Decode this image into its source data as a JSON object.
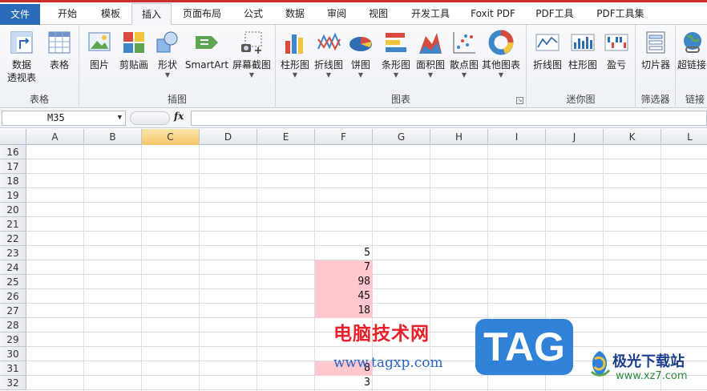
{
  "tabs": [
    {
      "label": "文件"
    },
    {
      "label": "开始"
    },
    {
      "label": "模板"
    },
    {
      "label": "插入"
    },
    {
      "label": "页面布局"
    },
    {
      "label": "公式"
    },
    {
      "label": "数据"
    },
    {
      "label": "审阅"
    },
    {
      "label": "视图"
    },
    {
      "label": "开发工具"
    },
    {
      "label": "Foxit PDF"
    },
    {
      "label": "PDF工具"
    },
    {
      "label": "PDF工具集"
    }
  ],
  "active_tab": "插入",
  "ribbon": {
    "groups": {
      "table": {
        "label": "表格",
        "buttons": {
          "pivot_line1": "数据",
          "pivot_line2": "透视表",
          "table": "表格"
        }
      },
      "illustrations": {
        "label": "插图",
        "buttons": {
          "picture": "图片",
          "clipart": "剪贴画",
          "shapes": "形状",
          "smartart": "SmartArt",
          "screenshot": "屏幕截图"
        }
      },
      "charts": {
        "label": "图表",
        "buttons": {
          "column": "柱形图",
          "line": "折线图",
          "pie": "饼图",
          "bar": "条形图",
          "area": "面积图",
          "scatter": "散点图",
          "other": "其他图表"
        }
      },
      "sparklines": {
        "label": "迷你图",
        "buttons": {
          "line": "折线图",
          "column": "柱形图",
          "winloss": "盈亏"
        }
      },
      "filter": {
        "label": "筛选器",
        "buttons": {
          "slicer": "切片器"
        }
      },
      "links": {
        "label": "链接",
        "buttons": {
          "hyperlink": "超链接"
        }
      }
    }
  },
  "formula_bar": {
    "name_box": "M35",
    "fx": "fx",
    "formula": ""
  },
  "grid": {
    "columns": [
      "A",
      "B",
      "C",
      "D",
      "E",
      "F",
      "G",
      "H",
      "I",
      "J",
      "K",
      "L"
    ],
    "selected_column": "C",
    "rows": [
      "16",
      "17",
      "18",
      "19",
      "20",
      "21",
      "22",
      "23",
      "24",
      "25",
      "26",
      "27",
      "28",
      "29",
      "30",
      "31",
      "32"
    ],
    "column_F_values": {
      "23": "5",
      "24": "7",
      "25": "98",
      "26": "45",
      "27": "18",
      "30": "8",
      "31": "3"
    },
    "highlight_color": "#ffc7ce"
  },
  "watermarks": {
    "site1_title": "电脑技术网",
    "site1_url": "www.tagxp.com",
    "tag_text": "TAG",
    "site2_title": "极光下载站",
    "site2_url": "www.xz7.com"
  },
  "colors": {
    "file_tab": "#2a6bb8",
    "accent_red": "#c9302c",
    "tag_blue": "#2f82d8"
  }
}
